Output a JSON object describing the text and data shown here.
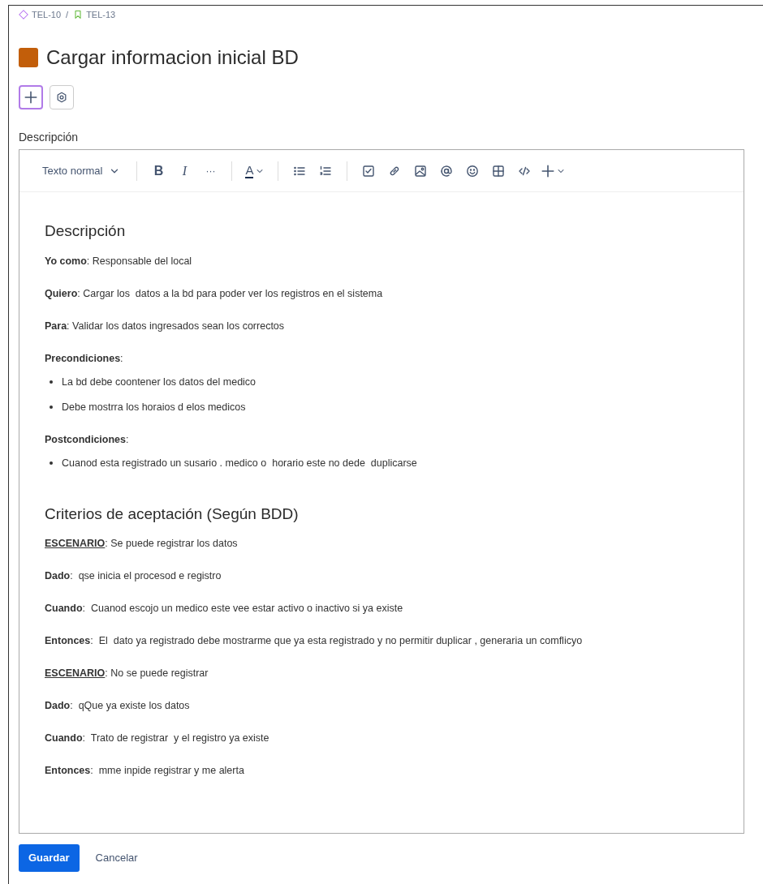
{
  "breadcrumbs": [
    {
      "kind": "epic",
      "label": "TEL-10"
    },
    {
      "kind": "story",
      "label": "TEL-13"
    }
  ],
  "breadcrumb_separator": "/",
  "issue": {
    "title": "Cargar informacion inicial BD",
    "color": "#c25e0a"
  },
  "actions": [
    {
      "kind": "add",
      "selected": true
    },
    {
      "kind": "apps",
      "selected": false
    }
  ],
  "field_label": "Descripción",
  "toolbar": [
    [
      {
        "kind": "text_style",
        "label": "Texto normal"
      }
    ],
    [
      {
        "kind": "bold",
        "label": "B"
      },
      {
        "kind": "italic",
        "label": "I"
      },
      {
        "kind": "more",
        "label": "···"
      }
    ],
    [
      {
        "kind": "text_color",
        "label": "A"
      }
    ],
    [
      {
        "kind": "bullet_list"
      },
      {
        "kind": "numbered_list"
      }
    ],
    [
      {
        "kind": "task"
      },
      {
        "kind": "link"
      },
      {
        "kind": "image"
      },
      {
        "kind": "mention"
      },
      {
        "kind": "emoji"
      },
      {
        "kind": "table"
      },
      {
        "kind": "code"
      },
      {
        "kind": "insert"
      }
    ]
  ],
  "content": [
    {
      "kind": "heading",
      "text": "Descripción"
    },
    {
      "kind": "field",
      "label": "Yo como",
      "underlined": false,
      "text": ": Responsable del local"
    },
    {
      "kind": "field",
      "label": "Quiero",
      "underlined": false,
      "text": ": Cargar los  datos a la bd para poder ver los registros en el sistema"
    },
    {
      "kind": "field",
      "label": "Para",
      "underlined": false,
      "text": ": Validar los datos ingresados sean los correctos"
    },
    {
      "kind": "field",
      "label": "Precondiciones",
      "underlined": false,
      "text": ":"
    },
    {
      "kind": "bullets",
      "items": [
        "La bd debe coontener los datos del medico",
        "Debe mostrra los horaios d elos medicos"
      ]
    },
    {
      "kind": "field",
      "label": "Postcondiciones",
      "underlined": false,
      "text": ":"
    },
    {
      "kind": "bullets",
      "items": [
        "Cuanod esta registrado un susario . medico o  horario este no dede  duplicarse"
      ]
    },
    {
      "kind": "heading",
      "text": "Criterios de aceptación (Según BDD)"
    },
    {
      "kind": "field",
      "label": "ESCENARIO",
      "underlined": true,
      "text": ": Se puede registrar los datos"
    },
    {
      "kind": "field",
      "label": "Dado",
      "underlined": false,
      "text": ":  qse inicia el procesod e registro"
    },
    {
      "kind": "field",
      "label": "Cuando",
      "underlined": false,
      "text": ":  Cuanod escojo un medico este vee estar activo o inactivo si ya existe"
    },
    {
      "kind": "field",
      "label": "Entonces",
      "underlined": false,
      "text": ":  El  dato ya registrado debe mostrarme que ya esta registrado y no permitir duplicar , generaria un comflicyo"
    },
    {
      "kind": "field",
      "label": "ESCENARIO",
      "underlined": true,
      "text": ": No se puede registrar"
    },
    {
      "kind": "field",
      "label": "Dado",
      "underlined": false,
      "text": ":  qQue ya existe los datos"
    },
    {
      "kind": "field",
      "label": "Cuando",
      "underlined": false,
      "text": ":  Trato de registrar  y el registro ya existe"
    },
    {
      "kind": "field",
      "label": "Entonces",
      "underlined": false,
      "text": ":  mme inpide registrar y me alerta"
    }
  ],
  "buttons": [
    {
      "kind": "primary",
      "label": "Guardar"
    },
    {
      "kind": "subtle",
      "label": "Cancelar"
    }
  ]
}
